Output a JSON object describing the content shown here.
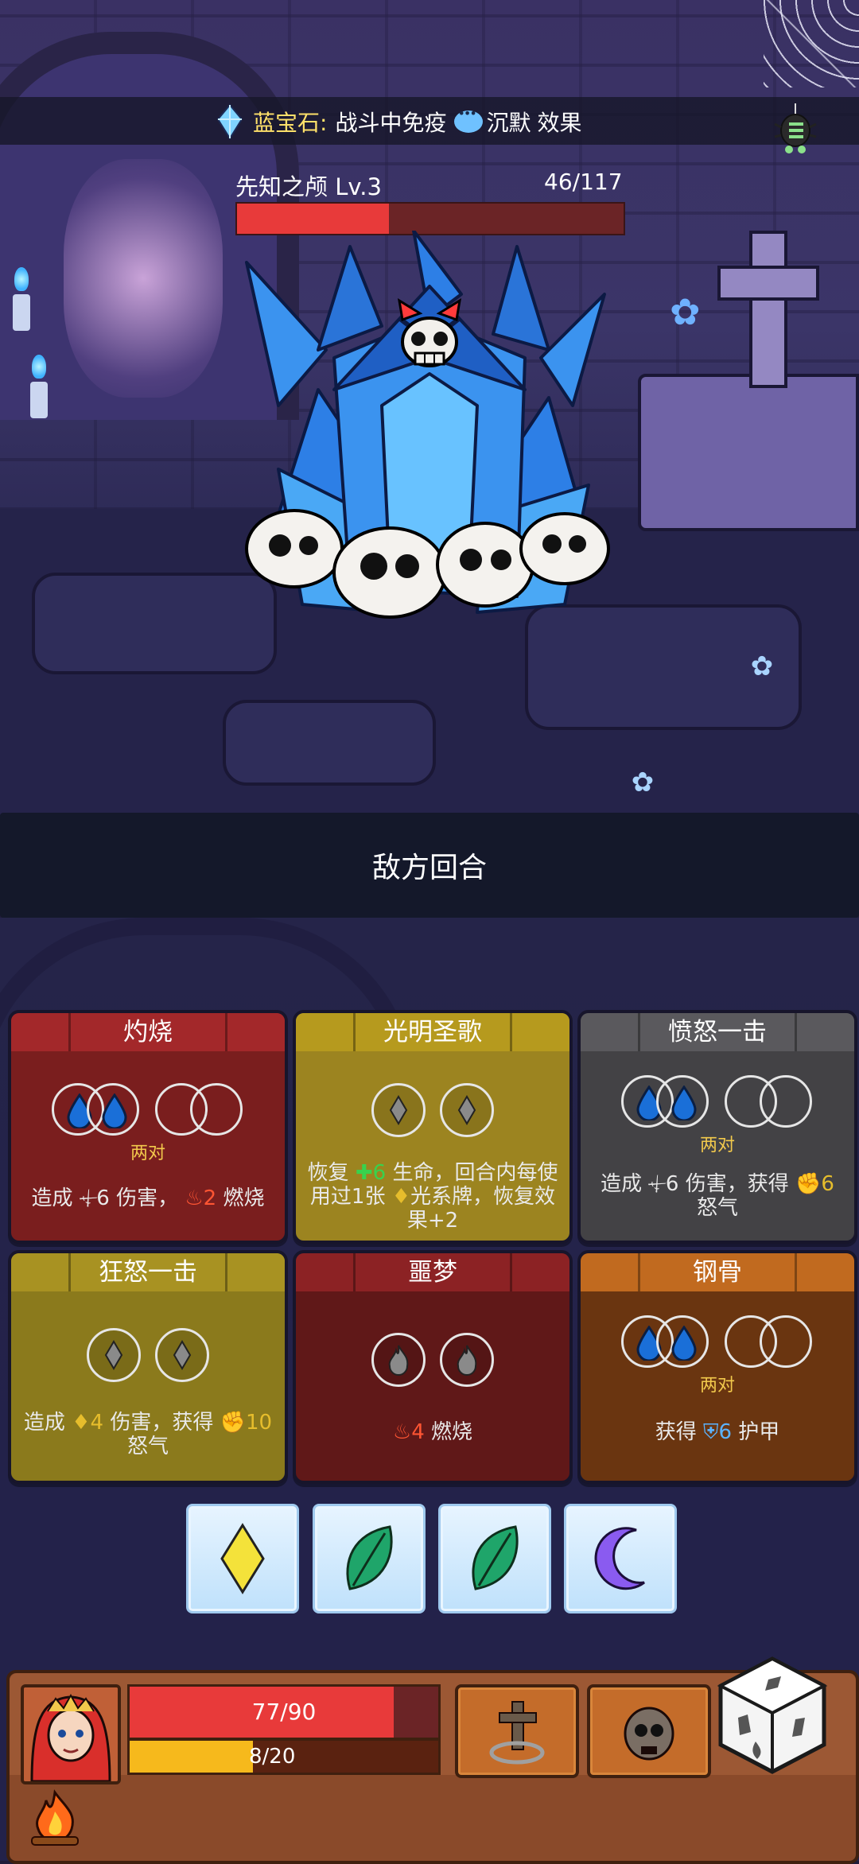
{
  "top_banner": {
    "gem_label": "蓝宝石:",
    "gem_effect_prefix": "战斗中免疫",
    "gem_effect_status": "沉默",
    "gem_effect_suffix": "效果"
  },
  "enemy": {
    "name": "先知之颅  Lv.3",
    "hp_text": "46/117",
    "hp_fraction": 0.393
  },
  "turn_banner": "敌方回合",
  "cards": [
    {
      "title": "灼烧",
      "color": "#7a1e1e",
      "title_color": "#a3282a",
      "pair_label": "两对",
      "desc_1": "造成",
      "desc_2": "6 伤害，",
      "desc_3": "2",
      "desc_4": "燃烧"
    },
    {
      "title": "光明圣歌",
      "color": "#9c8420",
      "title_color": "#b69a1e",
      "desc_1": "恢复",
      "desc_2": "6",
      "desc_3": "生命，回合内每使用过1张",
      "desc_4": "光系牌，恢复效果+2"
    },
    {
      "title": "愤怒一击",
      "color": "#434245",
      "title_color": "#5a595d",
      "pair_label": "两对",
      "desc_1": "造成",
      "desc_2": "6 伤害，获得",
      "desc_3": "6",
      "desc_4": "怒气"
    },
    {
      "title": "狂怒一击",
      "color": "#8b7a1c",
      "title_color": "#a89222",
      "desc_1": "造成",
      "desc_2": "4",
      "desc_3": "伤害，获得",
      "desc_4": "10",
      "desc_5": "怒气"
    },
    {
      "title": "噩梦",
      "color": "#601818",
      "title_color": "#8c2224",
      "desc_1": "4",
      "desc_2": "燃烧"
    },
    {
      "title": "钢骨",
      "color": "#6a3510",
      "title_color": "#c16a1f",
      "pair_label": "两对",
      "desc_1": "获得",
      "desc_2": "6",
      "desc_3": "护甲"
    }
  ],
  "dice": [
    {
      "icon": "yellow-diamond-icon",
      "color": "#f4e23a"
    },
    {
      "icon": "green-leaf-icon",
      "color": "#1fa56a"
    },
    {
      "icon": "green-leaf-icon",
      "color": "#1fa56a"
    },
    {
      "icon": "purple-moon-icon",
      "color": "#8a5bf0"
    }
  ],
  "player": {
    "hp_text": "77/90",
    "hp_fraction": 0.856,
    "rage_text": "8/20",
    "rage_fraction": 0.4
  }
}
